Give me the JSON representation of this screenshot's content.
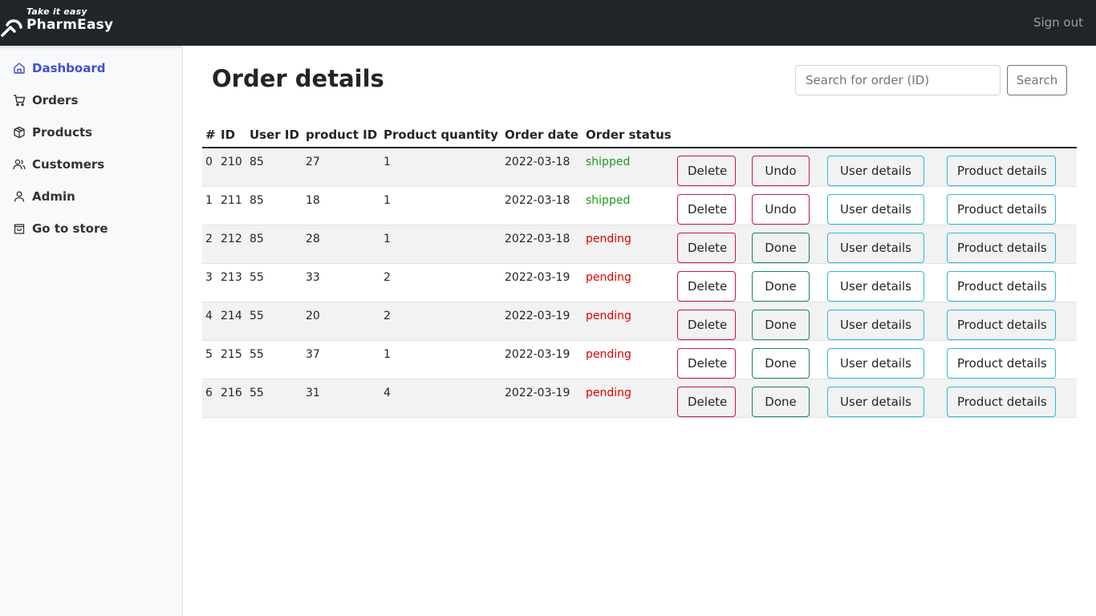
{
  "brand": {
    "tagline": "Take it easy",
    "name": "PharmEasy"
  },
  "header": {
    "signout_label": "Sign out"
  },
  "sidebar": {
    "items": [
      {
        "label": "Dashboard",
        "icon": "home-icon",
        "active": true
      },
      {
        "label": "Orders",
        "icon": "cart-icon",
        "active": false
      },
      {
        "label": "Products",
        "icon": "box-icon",
        "active": false
      },
      {
        "label": "Customers",
        "icon": "users-icon",
        "active": false
      },
      {
        "label": "Admin",
        "icon": "user-icon",
        "active": false
      },
      {
        "label": "Go to store",
        "icon": "bag-icon",
        "active": false
      }
    ]
  },
  "main": {
    "title": "Order details",
    "search": {
      "placeholder": "Search for order (ID)",
      "value": "",
      "button_label": "Search"
    }
  },
  "table": {
    "columns": [
      "#",
      "ID",
      "User ID",
      "product ID",
      "Product quantity",
      "Order date",
      "Order status"
    ],
    "rows": [
      {
        "index": "0",
        "id": "210",
        "user_id": "85",
        "product_id": "27",
        "quantity": "1",
        "date": "2022-03-18",
        "status": "shipped",
        "toggle_label": "Undo"
      },
      {
        "index": "1",
        "id": "211",
        "user_id": "85",
        "product_id": "18",
        "quantity": "1",
        "date": "2022-03-18",
        "status": "shipped",
        "toggle_label": "Undo"
      },
      {
        "index": "2",
        "id": "212",
        "user_id": "85",
        "product_id": "28",
        "quantity": "1",
        "date": "2022-03-18",
        "status": "pending",
        "toggle_label": "Done"
      },
      {
        "index": "3",
        "id": "213",
        "user_id": "55",
        "product_id": "33",
        "quantity": "2",
        "date": "2022-03-19",
        "status": "pending",
        "toggle_label": "Done"
      },
      {
        "index": "4",
        "id": "214",
        "user_id": "55",
        "product_id": "20",
        "quantity": "2",
        "date": "2022-03-19",
        "status": "pending",
        "toggle_label": "Done"
      },
      {
        "index": "5",
        "id": "215",
        "user_id": "55",
        "product_id": "37",
        "quantity": "1",
        "date": "2022-03-19",
        "status": "pending",
        "toggle_label": "Done"
      },
      {
        "index": "6",
        "id": "216",
        "user_id": "55",
        "product_id": "31",
        "quantity": "4",
        "date": "2022-03-19",
        "status": "pending",
        "toggle_label": "Done"
      }
    ],
    "actions": {
      "delete_label": "Delete",
      "user_details_label": "User details",
      "product_details_label": "Product details"
    }
  },
  "colors": {
    "topbar": "#212529",
    "active_nav": "#3f4fcf",
    "shipped": "#1a9c1a",
    "pending": "#e00000",
    "delete_border": "#c3174a",
    "undo_border": "#c3174a",
    "done_border": "#198754",
    "info_border": "#2bbbd8"
  }
}
